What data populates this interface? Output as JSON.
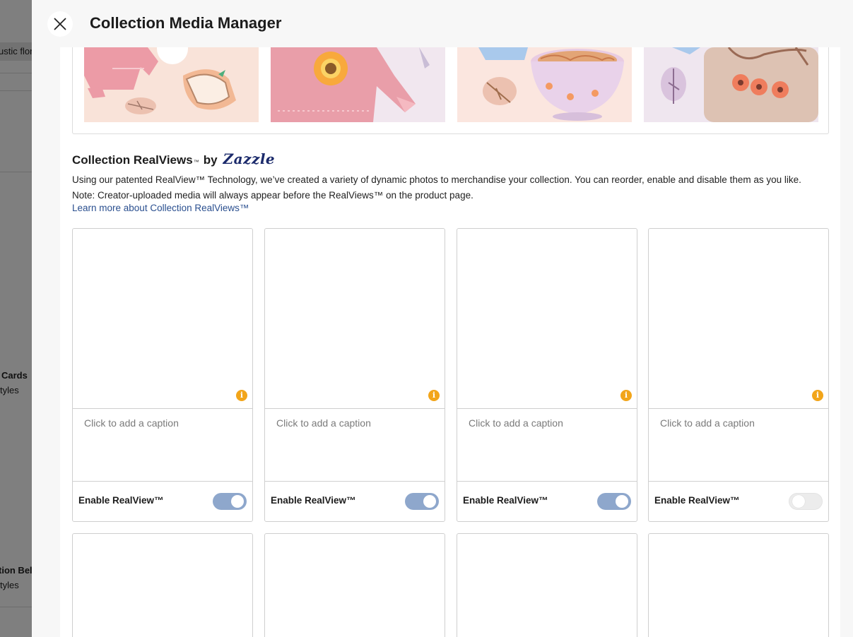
{
  "background_page": {
    "items": [
      {
        "text": "ustic flor"
      },
      {
        "text": "Cards"
      },
      {
        "text": "tyles"
      },
      {
        "text": "tion Bel"
      },
      {
        "text": "tyles"
      }
    ]
  },
  "modal": {
    "title": "Collection Media Manager",
    "close_icon": "close-icon"
  },
  "uploaded_media": [
    {
      "name": "sweater-and-cap-illustration"
    },
    {
      "name": "pink-sweater-sunflower-illustration"
    },
    {
      "name": "noodle-bowl-illustration"
    },
    {
      "name": "floral-tote-bag-illustration"
    }
  ],
  "realviews": {
    "heading": "Collection RealViews",
    "trademark": "™",
    "by": "by",
    "brand": "Zazzle",
    "description_line1": "Using our patented RealView™ Technology, we’ve created a variety of dynamic photos to merchandise your collection. You can reorder, enable and disable them as you like.",
    "description_line2": "Note: Creator-uploaded media will always appear before the RealViews™ on the product page.",
    "learn_more": "Learn more about Collection RealViews™",
    "cards": [
      {
        "caption_placeholder": "Click to add a caption",
        "enable_label": "Enable RealView™",
        "enabled": true
      },
      {
        "caption_placeholder": "Click to add a caption",
        "enable_label": "Enable RealView™",
        "enabled": true
      },
      {
        "caption_placeholder": "Click to add a caption",
        "enable_label": "Enable RealView™",
        "enabled": true
      },
      {
        "caption_placeholder": "Click to add a caption",
        "enable_label": "Enable RealView™",
        "enabled": false
      }
    ],
    "info_icon": "i",
    "accent_color": "#8ea7cc",
    "info_color": "#f2a51a",
    "link_color": "#2a4f8f"
  }
}
